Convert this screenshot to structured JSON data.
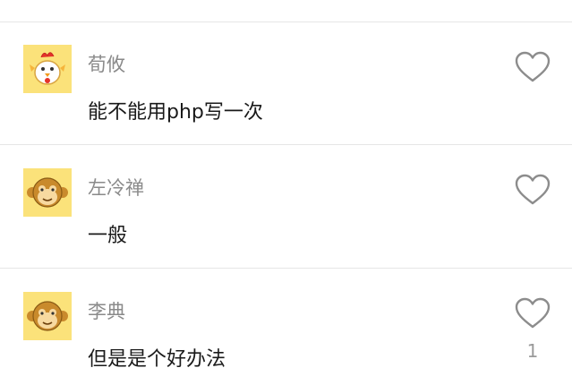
{
  "comments": [
    {
      "username": "荀攸",
      "content": "能不能用php写一次",
      "avatar": "rooster-avatar",
      "likes": ""
    },
    {
      "username": "左冷禅",
      "content": "一般",
      "avatar": "monkey-avatar",
      "likes": ""
    },
    {
      "username": "李典",
      "content": "但是是个好办法",
      "avatar": "monkey-avatar",
      "likes": "1"
    }
  ],
  "colors": {
    "avatar_bg": "#fbe27a",
    "username": "#8a8a8a",
    "content": "#1a1a1a",
    "divider": "#e6e6e6"
  }
}
